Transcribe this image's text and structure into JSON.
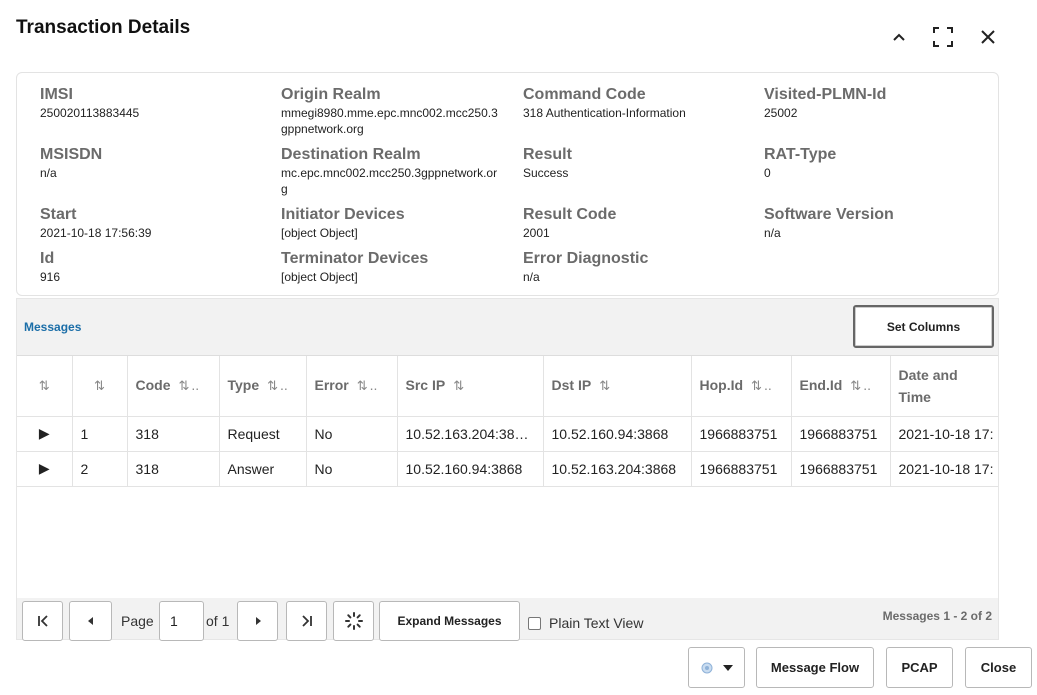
{
  "dialog": {
    "title": "Transaction Details"
  },
  "details": {
    "imsi": {
      "label": "IMSI",
      "value": "250020113883445"
    },
    "origin_realm": {
      "label": "Origin Realm",
      "value": "mmegi8980.mme.epc.mnc002.mcc250.3gppnetwork.org"
    },
    "command_code": {
      "label": "Command Code",
      "value": "318 Authentication-Information"
    },
    "visited_plmn": {
      "label": "Visited-PLMN-Id",
      "value": "25002"
    },
    "msisdn": {
      "label": "MSISDN",
      "value": "n/a"
    },
    "destination_realm": {
      "label": "Destination Realm",
      "value": "mc.epc.mnc002.mcc250.3gppnetwork.org"
    },
    "result": {
      "label": "Result",
      "value": "Success"
    },
    "rat_type": {
      "label": "RAT-Type",
      "value": "0"
    },
    "start": {
      "label": "Start",
      "value": "2021-10-18 17:56:39"
    },
    "initiator_devices": {
      "label": "Initiator Devices",
      "value": "[object Object]"
    },
    "result_code": {
      "label": "Result Code",
      "value": "2001"
    },
    "software_version": {
      "label": "Software Version",
      "value": "n/a"
    },
    "id": {
      "label": "Id",
      "value": "916"
    },
    "terminator_devices": {
      "label": "Terminator Devices",
      "value": "[object Object]"
    },
    "error_diagnostic": {
      "label": "Error Diagnostic",
      "value": "n/a"
    }
  },
  "messages": {
    "label": "Messages",
    "set_columns_label": "Set Columns",
    "columns": {
      "code": "Code",
      "type": "Type",
      "error": "Error",
      "src_ip": "Src IP",
      "dst_ip": "Dst IP",
      "hop_id": "Hop.Id",
      "end_id": "End.Id",
      "date_time": "Date and Time"
    },
    "rows": [
      {
        "num": "1",
        "code": "318",
        "type": "Request",
        "error": "No",
        "src_ip": "10.52.163.204:38…",
        "dst_ip": "10.52.160.94:3868",
        "hop_id": "1966883751",
        "end_id": "1966883751",
        "date_time": "2021-10-18 17:"
      },
      {
        "num": "2",
        "code": "318",
        "type": "Answer",
        "error": "No",
        "src_ip": "10.52.160.94:3868",
        "dst_ip": "10.52.163.204:3868",
        "hop_id": "1966883751",
        "end_id": "1966883751",
        "date_time": "2021-10-18 17:"
      }
    ]
  },
  "pager": {
    "page_label": "Page",
    "page_value": "1",
    "of_label": "of 1",
    "expand_label": "Expand Messages",
    "plain_text_label": "Plain Text View",
    "count_label": "Messages 1 - 2 of 2"
  },
  "footer": {
    "message_flow_label": "Message Flow",
    "pcap_label": "PCAP",
    "close_label": "Close"
  },
  "icons": [
    "chevron-up-icon",
    "expand-icon",
    "close-icon",
    "sort-icon",
    "expand-row-icon",
    "first-page-icon",
    "prev-page-icon",
    "next-page-icon",
    "last-page-icon",
    "spinner-icon",
    "theme-dot-icon",
    "caret-down-icon"
  ],
  "colors": {
    "accent": "#1b6ea8",
    "label_gray": "#6b6b6b"
  }
}
